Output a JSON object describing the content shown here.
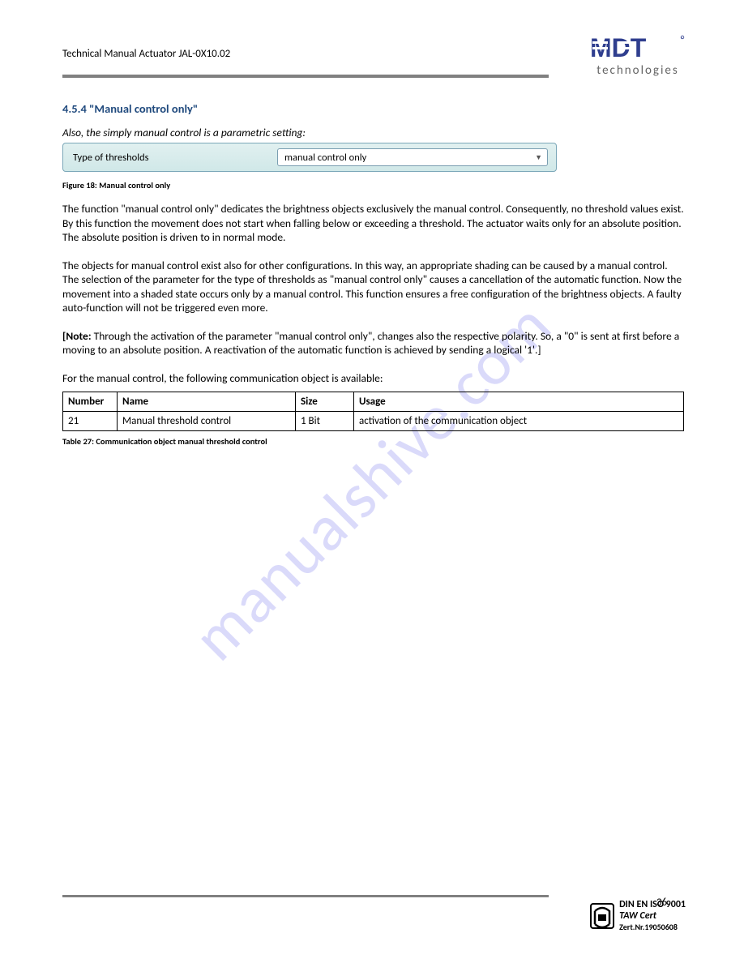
{
  "header": {
    "title": "Technical Manual Actuator  JAL-0X10.02"
  },
  "logo": {
    "name": "MDT",
    "sub": "technologies"
  },
  "section": {
    "heading": "4.5.4 \"Manual control only\"",
    "italic_intro": "Also, the simply manual control is a parametric setting:"
  },
  "control": {
    "label": "Type of thresholds",
    "value": "manual control only"
  },
  "figcap": "Figure 18: Manual control only",
  "paragraphs": {
    "p1": "The function \"manual control only\" dedicates the brightness objects exclusively the manual control. Consequently, no threshold values exist. By this function the movement does not start when falling below or exceeding a threshold. The actuator waits only for an absolute position. The absolute position is driven to in normal mode.",
    "p2a": "The objects for manual control exist also for other configurations. In this way, an appropriate shading can be caused by a manual control. ",
    "p2b": "The selection of the parameter for the type of thresholds as \"manual control only\" causes a cancellation of the automatic function. Now the movement into a shaded state occurs only by a manual control. This function ensures a free configuration of the brightness objects. A faulty auto-function will not be triggered even more.",
    "p3_prefix": "[Note:",
    "p3_rest": " Through the activation of the parameter \"manual control only\", changes also the respective polarity. So, a \"0\" is sent at first before a moving to an absolute position. A reactivation of the automatic function is achieved by sending a logical '1'.]",
    "p4": "For the manual control, the following communication object is available:"
  },
  "table": {
    "headers": {
      "number": "Number",
      "name": "Name",
      "size": "Size",
      "usage": "Usage"
    },
    "row": {
      "number": "21",
      "name": "Manual threshold control",
      "size": "1 Bit",
      "usage": "activation of the communication object"
    }
  },
  "tabcap": "Table 27: Communication object manual threshold control",
  "page_number": "36",
  "cert": {
    "l1": "DIN EN ISO 9001",
    "l2": "TAW Cert",
    "l3": "Zert.Nr.19050608"
  },
  "watermark": "manualshive.com"
}
